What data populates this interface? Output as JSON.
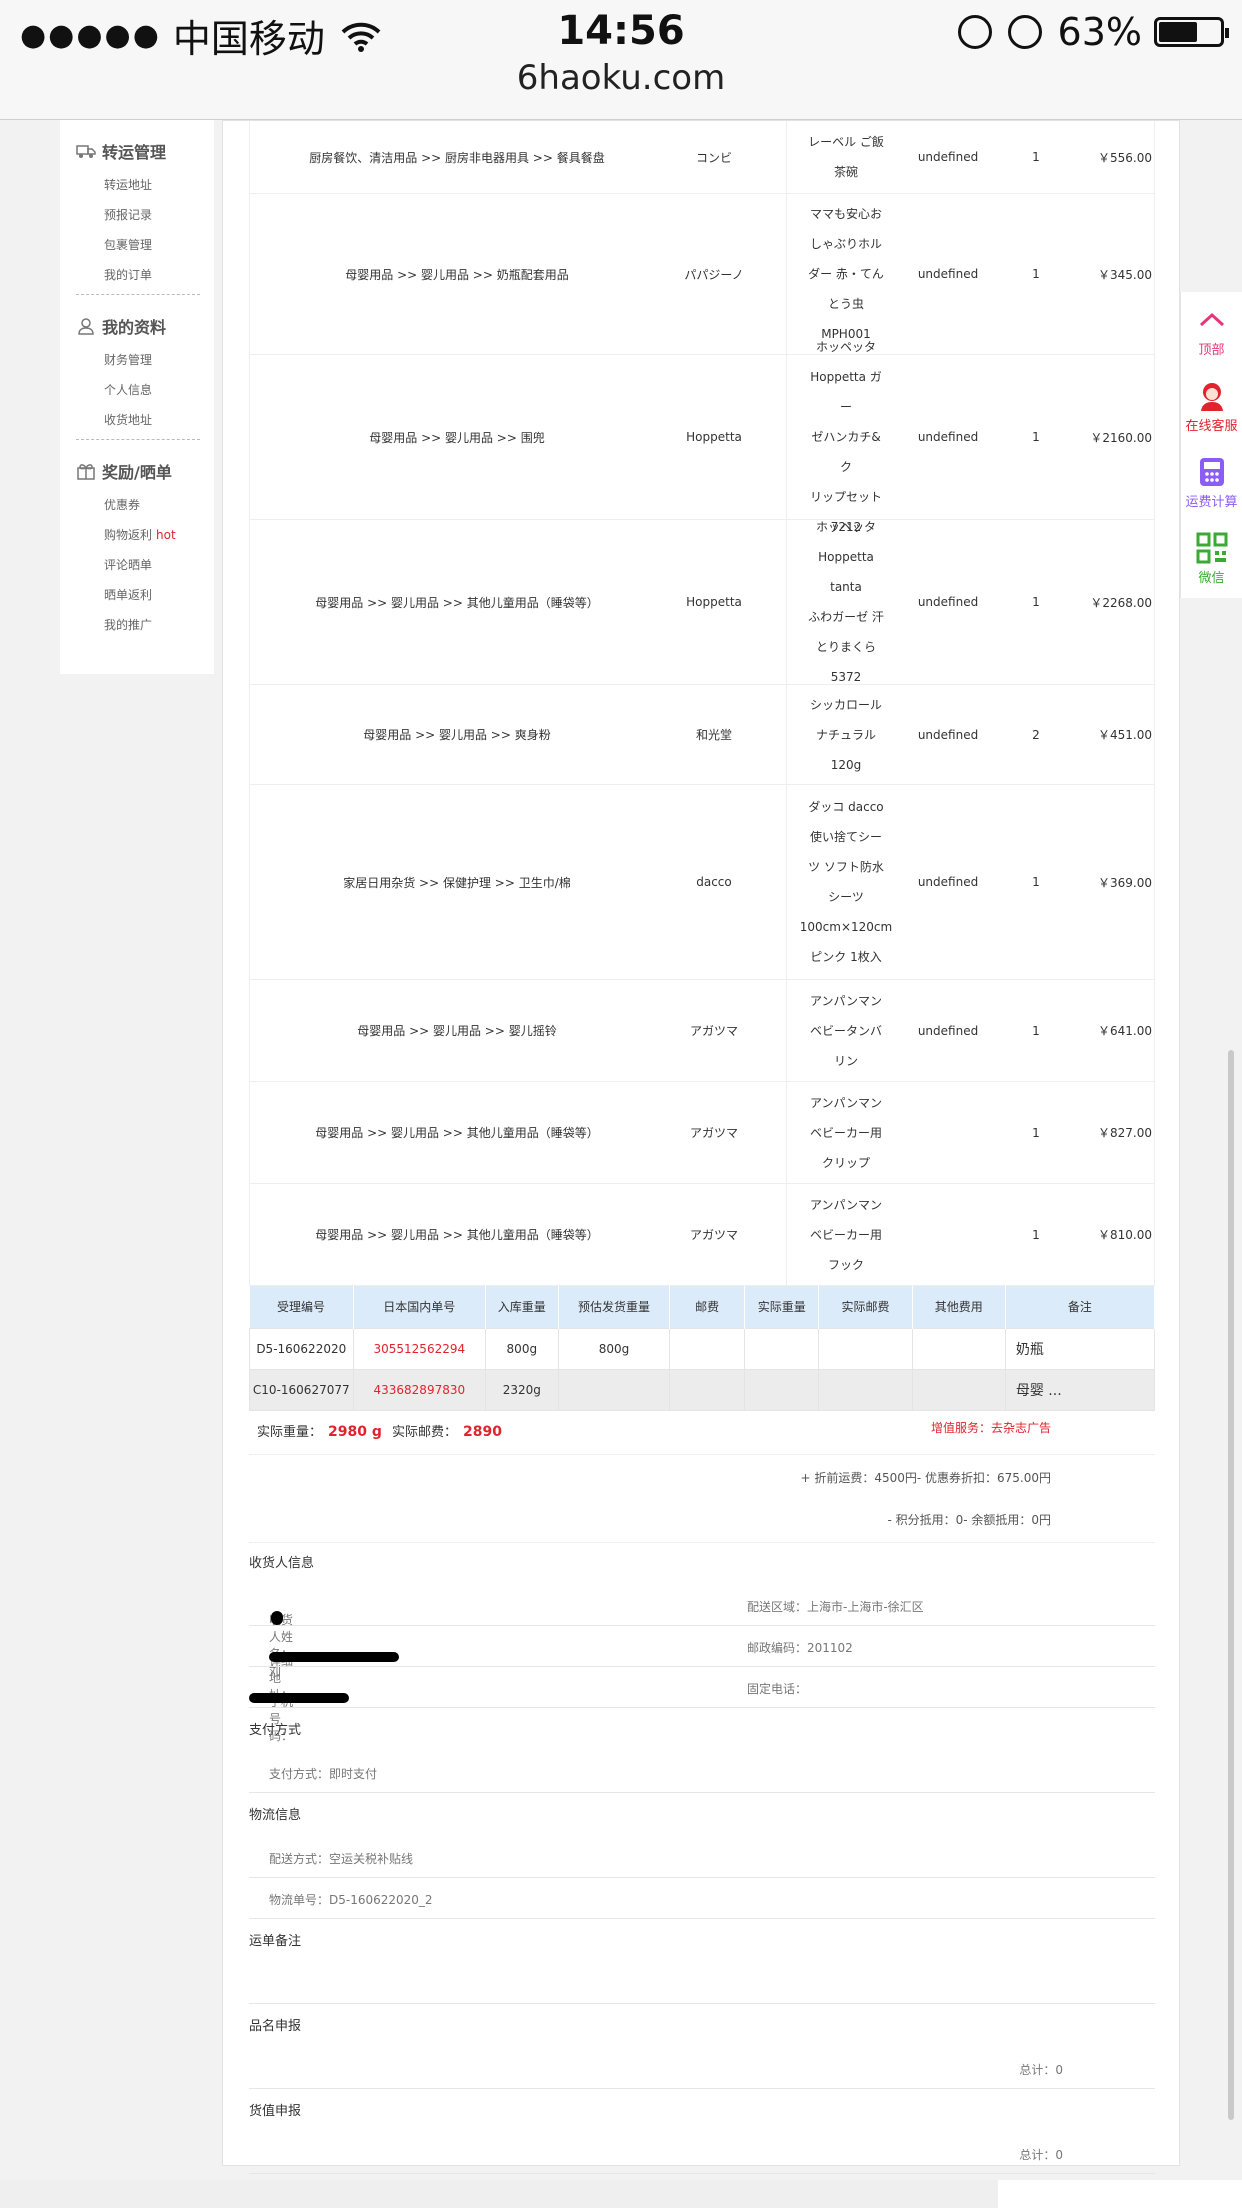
{
  "statusbar": {
    "carrier": "中国移动",
    "time": "14:56",
    "url": "6haoku.com",
    "battery": "63%",
    "battery_level": 0.63
  },
  "sidebar": {
    "groups": [
      {
        "title": "转运管理",
        "icon": "truck-icon",
        "items": [
          "转运地址",
          "预报记录",
          "包裹管理",
          "我的订单"
        ]
      },
      {
        "title": "我的资料",
        "icon": "user-icon",
        "items": [
          "财务管理",
          "个人信息",
          "收货地址"
        ]
      },
      {
        "title": "奖励/晒单",
        "icon": "gift-icon",
        "items": [
          "优惠券",
          "购物返利",
          "评论晒单",
          "晒单返利",
          "我的推广"
        ]
      }
    ],
    "hot_label": "hot"
  },
  "products": [
    {
      "category": "厨房餐饮、清洁用品 >> 厨房非电器用具 >> 餐具餐盘",
      "brand": "コンビ",
      "name": [
        "レーベル ご飯",
        "茶碗"
      ],
      "spec": "undefined",
      "qty": "1",
      "price": "￥556.00"
    },
    {
      "category": "母婴用品 >> 婴儿用品 >> 奶瓶配套用品",
      "brand": "パパジーノ",
      "name": [
        "ママも安心お",
        "しゃぶりホル",
        "ダー 赤・てん",
        "とう虫",
        "MPH001"
      ],
      "spec": "undefined",
      "qty": "1",
      "price": "￥345.00"
    },
    {
      "category": "母婴用品 >> 婴儿用品 >> 围兜",
      "brand": "Hoppetta",
      "name": [
        "ホッペッタ",
        "Hoppetta ガー",
        "ゼハンカチ&ク",
        "リップセット",
        "7212"
      ],
      "spec": "undefined",
      "qty": "1",
      "price": "￥2160.00"
    },
    {
      "category": "母婴用品 >> 婴儿用品 >> 其他儿童用品（睡袋等）",
      "brand": "Hoppetta",
      "name": [
        "ホッペッタ",
        "Hoppetta tanta",
        "ふわガーゼ 汗",
        "とりまくら",
        "5372"
      ],
      "spec": "undefined",
      "qty": "1",
      "price": "￥2268.00"
    },
    {
      "category": "母婴用品 >> 婴儿用品 >> 爽身粉",
      "brand": "和光堂",
      "name": [
        "シッカロール",
        "ナチュラル",
        "120g"
      ],
      "spec": "undefined",
      "qty": "2",
      "price": "￥451.00"
    },
    {
      "category": "家居日用杂货 >> 保健护理 >> 卫生巾/棉",
      "brand": "dacco",
      "name": [
        "ダッコ dacco",
        "使い捨てシー",
        "ツ ソフト防水",
        "シーツ",
        "100cm×120cm",
        "ピンク 1枚入"
      ],
      "spec": "undefined",
      "qty": "1",
      "price": "￥369.00"
    },
    {
      "category": "母婴用品 >> 婴儿用品 >> 婴儿摇铃",
      "brand": "アガツマ",
      "name": [
        "アンパンマン",
        "ベビータンバ",
        "リン"
      ],
      "spec": "undefined",
      "qty": "1",
      "price": "￥641.00"
    },
    {
      "category": "母婴用品 >> 婴儿用品 >> 其他儿童用品（睡袋等）",
      "brand": "アガツマ",
      "name": [
        "アンパンマン",
        "ベビーカー用",
        "クリップ"
      ],
      "spec": "",
      "qty": "1",
      "price": "￥827.00"
    },
    {
      "category": "母婴用品 >> 婴儿用品 >> 其他儿童用品（睡袋等）",
      "brand": "アガツマ",
      "name": [
        "アンパンマン",
        "ベビーカー用",
        "フック"
      ],
      "spec": "",
      "qty": "1",
      "price": "￥810.00"
    }
  ],
  "waybill": {
    "headers": [
      "受理编号",
      "日本国内单号",
      "入库重量",
      "预估发货重量",
      "邮费",
      "实际重量",
      "实际邮费",
      "其他费用",
      "备注"
    ],
    "rows": [
      [
        "D5-160622020",
        "305512562294",
        "800g",
        "800g",
        "",
        "",
        "",
        "",
        "奶瓶"
      ],
      [
        "C10-160627077",
        "433682897830",
        "2320g",
        "",
        "",
        "",
        "",
        "",
        "母婴 ..."
      ]
    ]
  },
  "summary": {
    "weight_label": "实际重量：",
    "weight_value": "2980 g",
    "postage_label": "实际邮费：",
    "postage_value": "2890",
    "service": "增值服务：去杂志广告",
    "fee_line1": "+ 折前运费：4500円- 优惠券折扣：675.00円",
    "fee_line2": "- 积分抵用：0- 余额抵用：0円"
  },
  "receiver": {
    "title": "收货人信息",
    "name_label": "收货人姓名：刘",
    "region_label": "配送区域：上海市-上海市-徐汇区",
    "address_label": "详细地址：",
    "postcode_label": "邮政编码：201102",
    "phone_label": "手机号码：",
    "tel_label": "固定电话："
  },
  "payment": {
    "title": "支付方式",
    "method": "支付方式：即时支付"
  },
  "logistics": {
    "title": "物流信息",
    "mode": "配送方式：空运关税补贴线",
    "number": "物流单号：D5-160622020_2"
  },
  "remark": {
    "title": "运单备注"
  },
  "name_declare": {
    "title": "品名申报",
    "total": "总计：0"
  },
  "value_declare": {
    "title": "货值申报",
    "total": "总计：0"
  },
  "floatbar": [
    {
      "label": "顶部",
      "icon": "chevron-up-icon",
      "color": "#e8347a"
    },
    {
      "label": "在线客服",
      "icon": "support-agent-icon",
      "color": "#e0232d"
    },
    {
      "label": "运费计算",
      "icon": "calculator-icon",
      "color": "#8b5cf6"
    },
    {
      "label": "微信",
      "icon": "qr-code-icon",
      "color": "#3aaa35"
    }
  ]
}
